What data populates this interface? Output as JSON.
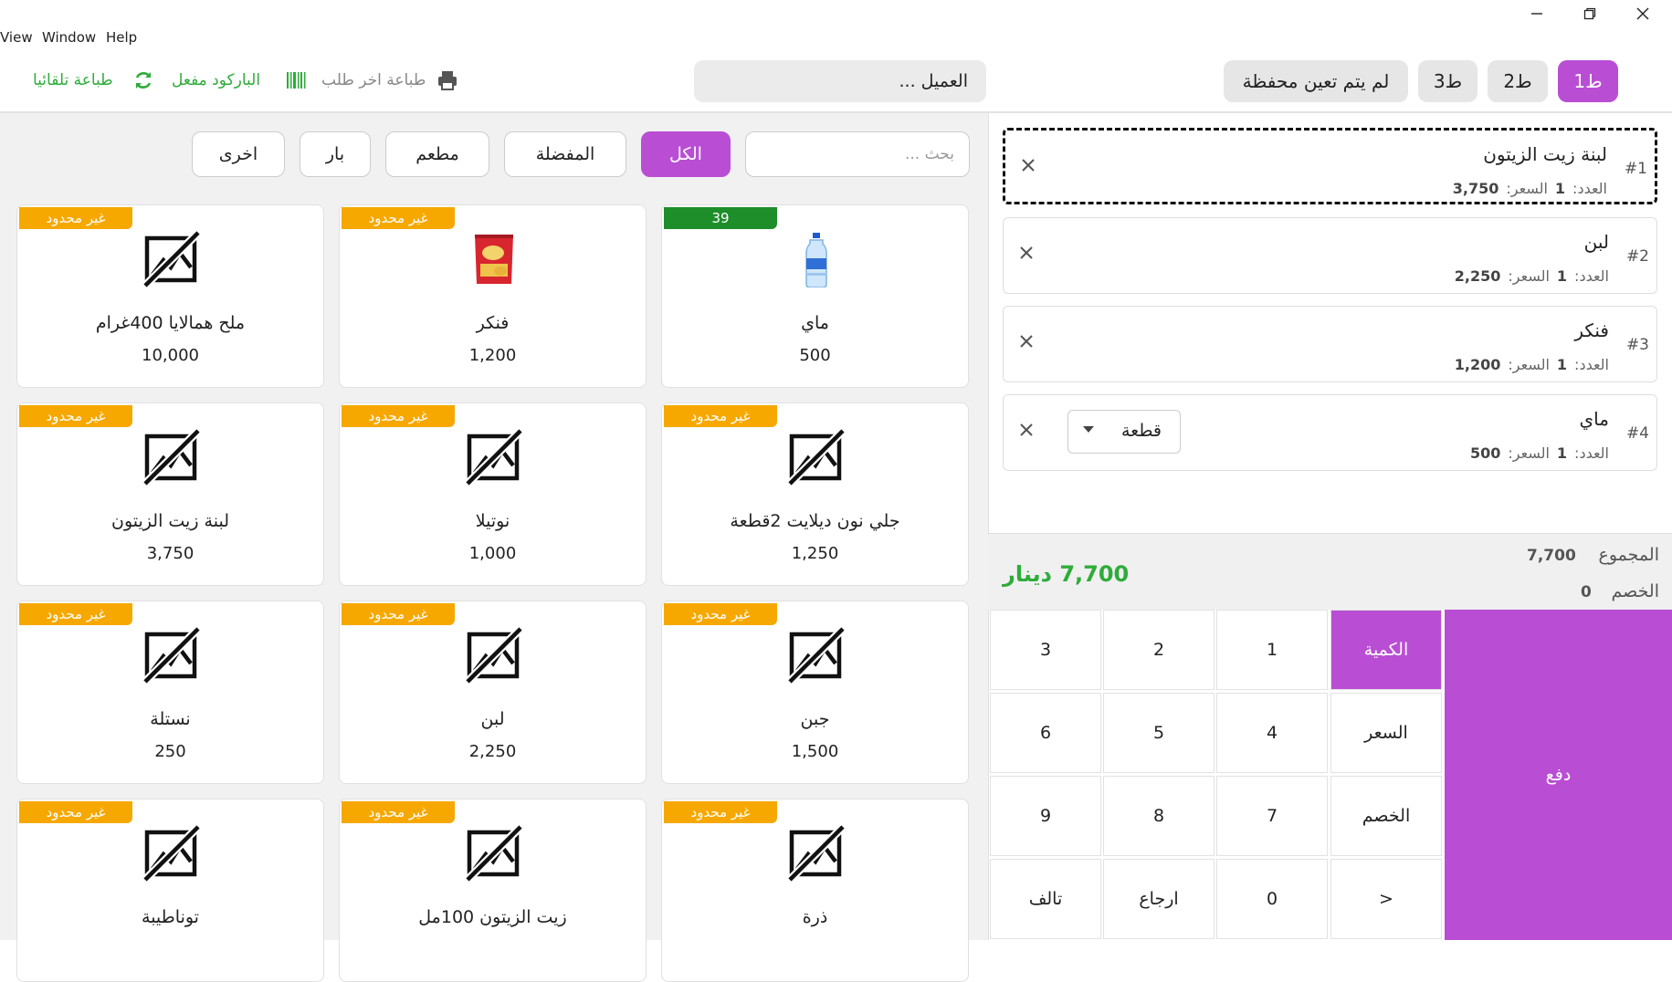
{
  "menu": [
    "View",
    "Window",
    "Help"
  ],
  "window_controls": [
    "minimize-icon",
    "restore-icon",
    "close-icon"
  ],
  "toolbar": {
    "auto_print": "طباعة تلقائيا",
    "barcode": "الباركود مفعل",
    "print_last": "طباعة اخر طلب",
    "accent_color": "#2eac3a"
  },
  "customer": {
    "placeholder": "العميل ..."
  },
  "order_tabs": [
    {
      "label": "1ط",
      "active": true
    },
    {
      "label": "2ط",
      "active": false
    },
    {
      "label": "3ط",
      "active": false
    },
    {
      "label": "لم يتم تعين محفظة",
      "active": false
    }
  ],
  "search": {
    "placeholder": "بحث ..."
  },
  "categories": [
    {
      "label": "الكل",
      "active": true
    },
    {
      "label": "المفضلة",
      "active": false
    },
    {
      "label": "مطعم",
      "active": false
    },
    {
      "label": "بار",
      "active": false
    },
    {
      "label": "اخرى",
      "active": false
    }
  ],
  "products": [
    {
      "name": "ماي",
      "price": "500",
      "badge": "39",
      "badge_color": "#1e8e2b",
      "image": "water-bottle"
    },
    {
      "name": "فنكر",
      "price": "1,200",
      "badge": "غير محدود",
      "badge_color": "#f6a800",
      "image": "chips-bag"
    },
    {
      "name": "ملح همالايا 400غرام",
      "price": "10,000",
      "badge": "غير محدود",
      "badge_color": "#f6a800",
      "image": "no-image"
    },
    {
      "name": "جلي نون ديلايت 2قطعة",
      "price": "1,250",
      "badge": "غير محدود",
      "badge_color": "#f6a800",
      "image": "no-image"
    },
    {
      "name": "نوتيلا",
      "price": "1,000",
      "badge": "غير محدود",
      "badge_color": "#f6a800",
      "image": "no-image"
    },
    {
      "name": "لبنة زيت الزيتون",
      "price": "3,750",
      "badge": "غير محدود",
      "badge_color": "#f6a800",
      "image": "no-image"
    },
    {
      "name": "جبن",
      "price": "1,500",
      "badge": "غير محدود",
      "badge_color": "#f6a800",
      "image": "no-image"
    },
    {
      "name": "لبن",
      "price": "2,250",
      "badge": "غير محدود",
      "badge_color": "#f6a800",
      "image": "no-image"
    },
    {
      "name": "نستلة",
      "price": "250",
      "badge": "غير محدود",
      "badge_color": "#f6a800",
      "image": "no-image"
    },
    {
      "name": "ذرة",
      "price": "",
      "badge": "غير محدود",
      "badge_color": "#f6a800",
      "image": "no-image"
    },
    {
      "name": "زيت الزيتون 100مل",
      "price": "",
      "badge": "غير محدود",
      "badge_color": "#f6a800",
      "image": "no-image"
    },
    {
      "name": "توناطيبة",
      "price": "",
      "badge": "غير محدود",
      "badge_color": "#f6a800",
      "image": "no-image"
    }
  ],
  "order_lines": [
    {
      "num": "#1",
      "name": "لبنة زيت الزيتون",
      "qty_label": "العدد:",
      "qty": "1",
      "price_label": "السعر:",
      "price": "3,750",
      "selected": true,
      "unit": ""
    },
    {
      "num": "#2",
      "name": "لبن",
      "qty_label": "العدد:",
      "qty": "1",
      "price_label": "السعر:",
      "price": "2,250",
      "selected": false,
      "unit": ""
    },
    {
      "num": "#3",
      "name": "فنكر",
      "qty_label": "العدد:",
      "qty": "1",
      "price_label": "السعر:",
      "price": "1,200",
      "selected": false,
      "unit": ""
    },
    {
      "num": "#4",
      "name": "ماي",
      "qty_label": "العدد:",
      "qty": "1",
      "price_label": "السعر:",
      "price": "500",
      "selected": false,
      "unit": "قطعة"
    }
  ],
  "totals": {
    "subtotal_label": "المجموع",
    "subtotal": "7,700",
    "discount_label": "الخصم",
    "discount": "0",
    "grand_total": "7,700 دينار"
  },
  "keypad": {
    "modes": [
      {
        "label": "الكمية",
        "active": true
      },
      {
        "label": "السعر",
        "active": false
      },
      {
        "label": "الخصم",
        "active": false
      },
      {
        "label": ">",
        "active": false
      }
    ],
    "rows": [
      [
        "1",
        "2",
        "3"
      ],
      [
        "4",
        "5",
        "6"
      ],
      [
        "7",
        "8",
        "9"
      ],
      [
        "0",
        "ارجاع",
        "تالف"
      ]
    ],
    "pay_label": "دفع",
    "accent_color": "#b94ed4"
  }
}
